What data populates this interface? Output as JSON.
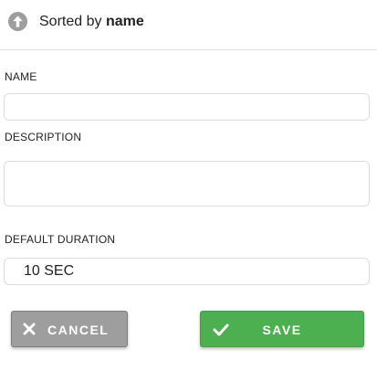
{
  "sort": {
    "prefix": "Sorted by",
    "field": "name"
  },
  "form": {
    "name": {
      "label": "NAME",
      "value": ""
    },
    "description": {
      "label": "DESCRIPTION",
      "value": ""
    },
    "default_duration": {
      "label": "DEFAULT DURATION",
      "value": "10 SEC"
    }
  },
  "buttons": {
    "cancel_label": "CANCEL",
    "save_label": "SAVE"
  },
  "colors": {
    "save": "#4caf50",
    "cancel": "#9e9e9e",
    "sort_icon": "#9e9e9e"
  },
  "icons": {
    "sort": "arrow-up-circle-icon",
    "cancel": "close-icon",
    "save": "check-icon"
  }
}
